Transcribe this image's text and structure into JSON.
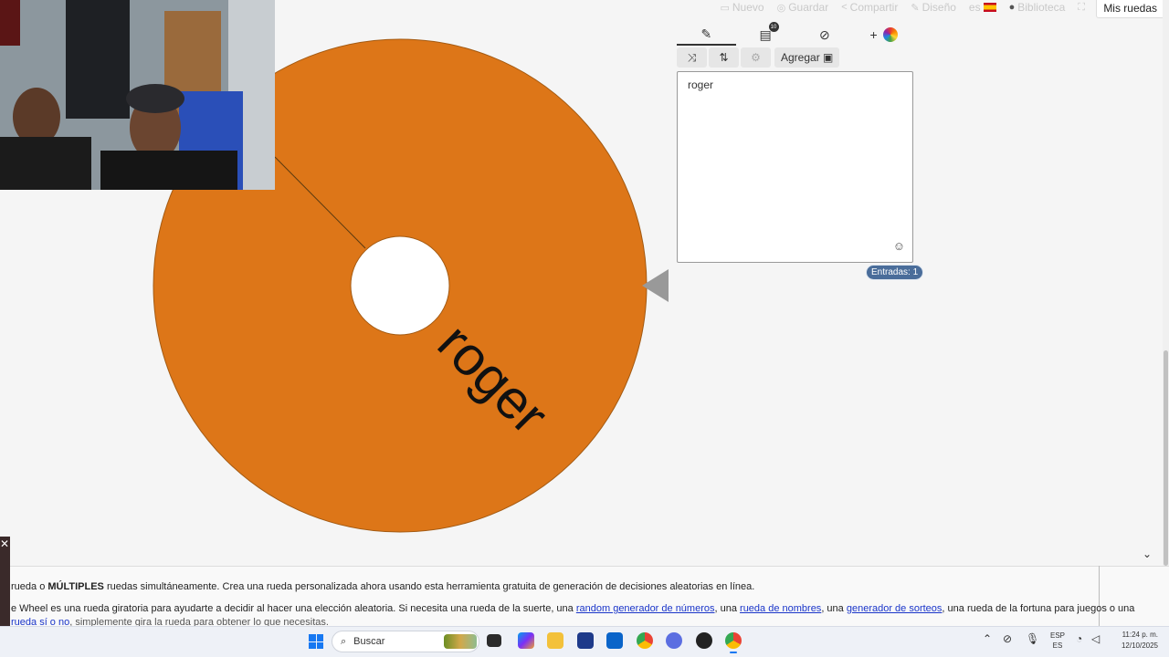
{
  "nav": {
    "items": [
      {
        "icon": "page-icon",
        "label": "Nuevo"
      },
      {
        "icon": "save-icon",
        "label": "Guardar"
      },
      {
        "icon": "share-icon",
        "label": "Compartir"
      },
      {
        "icon": "pencil-icon",
        "label": "Diseño"
      },
      {
        "icon": "flag-es-icon",
        "label": "es"
      },
      {
        "icon": "globe-icon",
        "label": "Biblioteca"
      }
    ],
    "mis_ruedas": "Mis ruedas"
  },
  "wheel": {
    "color": "#dd7618",
    "entry_label": "roger",
    "pointer_color": "#999999"
  },
  "editor": {
    "tabs": [
      "edit-icon",
      "results-icon",
      "hide-icon",
      "add-wheel-icon"
    ],
    "results_badge": "10",
    "tools": {
      "shuffle": "shuffle-icon",
      "sort": "sort-icon",
      "settings": "gear-icon",
      "agregar_label": "Agregar"
    },
    "entries_text": "roger",
    "count_label": "Entradas: 1"
  },
  "bottom": {
    "line1_a": "rueda o ",
    "line1_b": "MÚLTIPLES",
    "line1_c": " ruedas simultáneamente. Crea una rueda personalizada ahora usando esta herramienta gratuita de generación de decisiones aleatorias en línea.",
    "line2_a": "e Wheel es una rueda giratoria para ayudarte a decidir al hacer una elección aleatoria. Si necesita una rueda de la suerte, una ",
    "link1": "random generador de números",
    "line2_b": ", una ",
    "link2": "rueda de nombres",
    "line2_c": ", una ",
    "link3": "generador de sorteos",
    "line2_d": ", una rueda de la fortuna para juegos o una",
    "link4": "rueda sí o no",
    "line3_b": ", simplemente gira la rueda para obtener lo que necesitas."
  },
  "taskbar": {
    "search_placeholder": "Buscar",
    "lang_top": "ESP",
    "lang_bottom": "ES",
    "time": "11:24 p. m.",
    "date": "12/10/2025"
  }
}
